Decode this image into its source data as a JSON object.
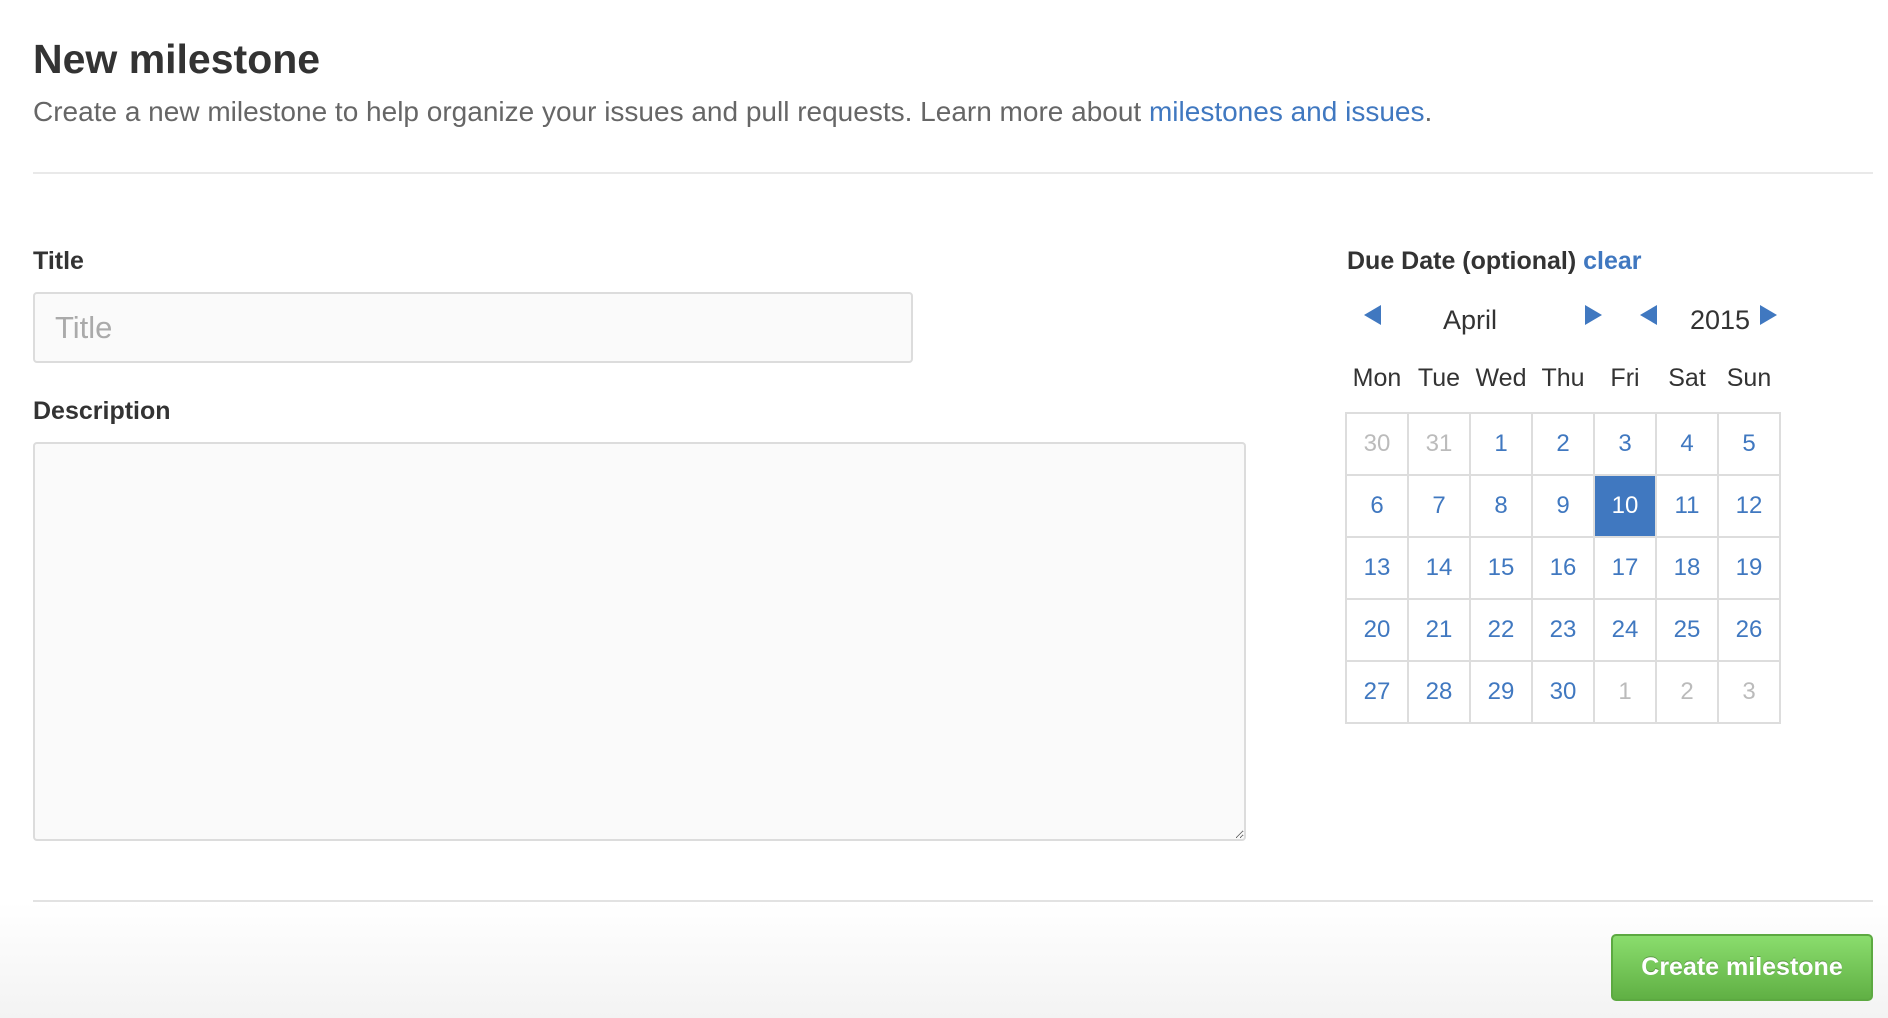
{
  "header": {
    "title": "New milestone",
    "description": "Create a new milestone to help organize your issues and pull requests. Learn more about ",
    "link_text": "milestones and issues",
    "link_suffix": "."
  },
  "form": {
    "title_label": "Title",
    "title_placeholder": "Title",
    "title_value": "",
    "description_label": "Description",
    "description_value": ""
  },
  "due_date": {
    "label": "Due Date (optional)",
    "clear_label": "clear",
    "month": "April",
    "year": "2015",
    "weekdays": [
      "Mon",
      "Tue",
      "Wed",
      "Thu",
      "Fri",
      "Sat",
      "Sun"
    ],
    "weeks": [
      [
        {
          "d": "30",
          "other": true
        },
        {
          "d": "31",
          "other": true
        },
        {
          "d": "1"
        },
        {
          "d": "2"
        },
        {
          "d": "3"
        },
        {
          "d": "4"
        },
        {
          "d": "5"
        }
      ],
      [
        {
          "d": "6"
        },
        {
          "d": "7"
        },
        {
          "d": "8"
        },
        {
          "d": "9"
        },
        {
          "d": "10",
          "selected": true
        },
        {
          "d": "11"
        },
        {
          "d": "12"
        }
      ],
      [
        {
          "d": "13"
        },
        {
          "d": "14"
        },
        {
          "d": "15"
        },
        {
          "d": "16"
        },
        {
          "d": "17"
        },
        {
          "d": "18"
        },
        {
          "d": "19"
        }
      ],
      [
        {
          "d": "20"
        },
        {
          "d": "21"
        },
        {
          "d": "22"
        },
        {
          "d": "23"
        },
        {
          "d": "24"
        },
        {
          "d": "25"
        },
        {
          "d": "26"
        }
      ],
      [
        {
          "d": "27"
        },
        {
          "d": "28"
        },
        {
          "d": "29"
        },
        {
          "d": "30"
        },
        {
          "d": "1",
          "other": true
        },
        {
          "d": "2",
          "other": true
        },
        {
          "d": "3",
          "other": true
        }
      ]
    ]
  },
  "actions": {
    "create_label": "Create milestone"
  },
  "colors": {
    "link": "#4078c0",
    "button_green": "#60b044",
    "selected_day": "#4078c0"
  }
}
